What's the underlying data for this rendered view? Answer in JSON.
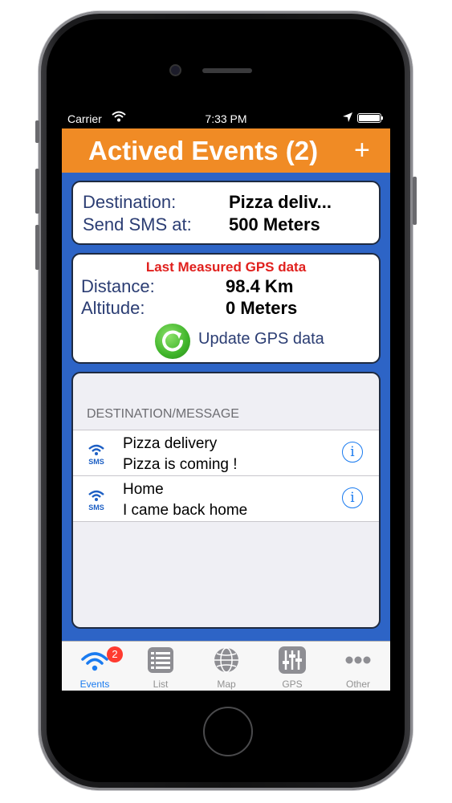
{
  "status_bar": {
    "carrier": "Carrier",
    "time": "7:33 PM"
  },
  "nav": {
    "title": "Actived Events (2)",
    "add_label": "+"
  },
  "destination_card": {
    "destination_label": "Destination:",
    "destination_value": "Pizza deliv...",
    "sms_label": "Send SMS at:",
    "sms_value": "500 Meters"
  },
  "gps_card": {
    "heading": "Last Measured GPS data",
    "distance_label": "Distance:",
    "distance_value": "98.4 Km",
    "altitude_label": "Altitude:",
    "altitude_value": "0 Meters",
    "update_label": "Update GPS data",
    "heading_color": "#e0201d"
  },
  "events": {
    "section_header": "DESTINATION/MESSAGE",
    "items": [
      {
        "icon": "sms-icon",
        "title": "Pizza delivery",
        "message": "Pizza is coming !"
      },
      {
        "icon": "sms-icon",
        "title": "Home",
        "message": "I came back home"
      }
    ]
  },
  "tabbar": {
    "tabs": [
      {
        "label": "Events",
        "icon": "wifi-icon",
        "active": true,
        "badge": "2"
      },
      {
        "label": "List",
        "icon": "list-icon",
        "active": false
      },
      {
        "label": "Map",
        "icon": "globe-icon",
        "active": false
      },
      {
        "label": "GPS",
        "icon": "sliders-icon",
        "active": false
      },
      {
        "label": "Other",
        "icon": "more-icon",
        "active": false
      }
    ]
  },
  "colors": {
    "navbar": "#f08b25",
    "background": "#2d64c6",
    "accent": "#1a7bf0"
  }
}
